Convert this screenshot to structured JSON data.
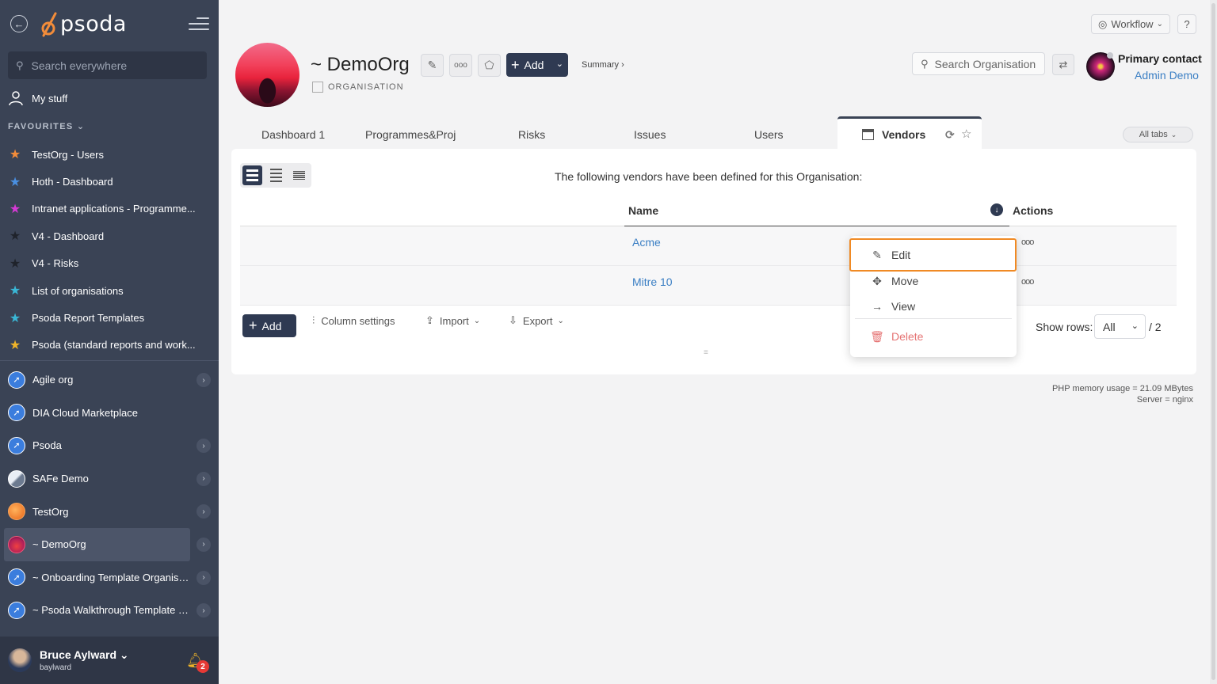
{
  "sidebar": {
    "logo": "psoda",
    "search_placeholder": "Search everywhere",
    "my_stuff": "My stuff",
    "favourites_heading": "FAVOURITES",
    "favourites": [
      {
        "label": "TestOrg - Users",
        "color": "#f28c3a"
      },
      {
        "label": "Hoth - Dashboard",
        "color": "#4a90e2"
      },
      {
        "label": "Intranet applications - Programme...",
        "color": "#d63ad6"
      },
      {
        "label": "V4 - Dashboard",
        "color": "#1f232b"
      },
      {
        "label": "V4 - Risks",
        "color": "#1f232b"
      },
      {
        "label": "List of organisations",
        "color": "#3ab7d6"
      },
      {
        "label": "Psoda Report Templates",
        "color": "#3ab7d6"
      },
      {
        "label": "Psoda (standard reports and work...",
        "color": "#f0b429"
      }
    ],
    "orgs": [
      {
        "label": "Agile org",
        "avatar": "comp",
        "chevron": true
      },
      {
        "label": "DIA Cloud Marketplace",
        "avatar": "comp",
        "chevron": false
      },
      {
        "label": "Psoda",
        "avatar": "comp",
        "chevron": true
      },
      {
        "label": "SAFe Demo",
        "avatar": "safe",
        "chevron": true
      },
      {
        "label": "TestOrg",
        "avatar": "test",
        "chevron": true
      },
      {
        "label": "~ DemoOrg",
        "avatar": "demo",
        "chevron": true,
        "active": true
      },
      {
        "label": "~ Onboarding Template Organisa...",
        "avatar": "comp",
        "chevron": true
      },
      {
        "label": "~ Psoda Walkthrough Template P...",
        "avatar": "comp",
        "chevron": true
      }
    ],
    "user": {
      "name": "Bruce Aylward",
      "handle": "baylward",
      "notifications": "2"
    }
  },
  "topbar": {
    "workflow_label": "Workflow",
    "help_label": "?"
  },
  "header": {
    "title": "~ DemoOrg",
    "subtitle": "ORGANISATION",
    "add_label": "Add",
    "summary_label": "Summary ›",
    "search_placeholder": "Search Organisation",
    "primary_contact_label": "Primary contact",
    "primary_contact_name": "Admin Demo"
  },
  "tabs": {
    "items": [
      "Dashboard 1",
      "Programmes&Proj",
      "Risks",
      "Issues",
      "Users"
    ],
    "active": "Vendors",
    "all_tabs": "All tabs"
  },
  "content": {
    "intro": "The following vendors have been defined for this Organisation:",
    "columns": {
      "name": "Name",
      "actions": "Actions"
    },
    "rows": [
      {
        "name": "Acme"
      },
      {
        "name": "Mitre 10"
      }
    ],
    "footer": {
      "add_label": "Add",
      "column_settings": "Column settings",
      "import": "Import",
      "export": "Export",
      "show_rows_label": "Show rows:",
      "show_rows_value": "All",
      "total": "/ 2"
    }
  },
  "action_menu": {
    "items": [
      {
        "label": "Edit",
        "icon": "pencil-icon"
      },
      {
        "label": "Move",
        "icon": "move-icon"
      },
      {
        "label": "View",
        "icon": "arrow-right-icon"
      },
      {
        "label": "Delete",
        "icon": "trash-icon"
      }
    ],
    "highlight_color": "#f08a24"
  },
  "stats": {
    "memory": "PHP memory usage = 21.09 MBytes",
    "server": "Server = nginx"
  }
}
